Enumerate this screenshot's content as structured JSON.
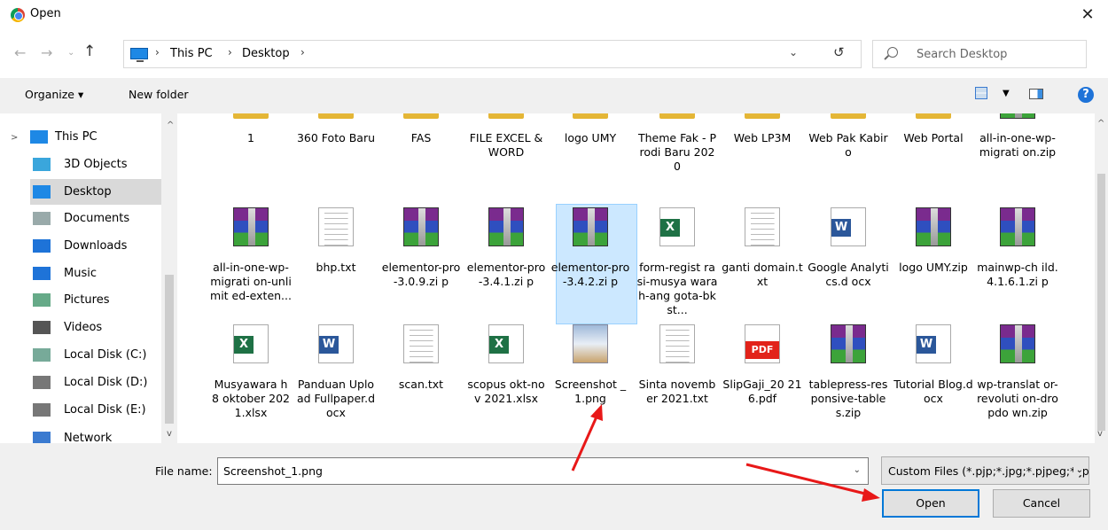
{
  "window": {
    "title": "Open",
    "close": "✕"
  },
  "nav": {
    "back": "←",
    "forward": "→",
    "recent": "⌄",
    "up": "↑",
    "crumbs": [
      "This PC",
      "Desktop"
    ],
    "refresh": "↻",
    "search_placeholder": "Search Desktop"
  },
  "toolbar": {
    "organize": "Organize ▾",
    "new_folder": "New folder",
    "help": "?"
  },
  "sidebar": {
    "items": [
      {
        "label": "This PC",
        "icon": "pc-icon"
      },
      {
        "label": "3D Objects",
        "icon": "cube-icon"
      },
      {
        "label": "Desktop",
        "icon": "desktop-icon",
        "selected": true
      },
      {
        "label": "Documents",
        "icon": "document-icon"
      },
      {
        "label": "Downloads",
        "icon": "download-icon"
      },
      {
        "label": "Music",
        "icon": "music-icon"
      },
      {
        "label": "Pictures",
        "icon": "pictures-icon"
      },
      {
        "label": "Videos",
        "icon": "video-icon"
      },
      {
        "label": "Local Disk (C:)",
        "icon": "drive-c-icon"
      },
      {
        "label": "Local Disk (D:)",
        "icon": "drive-icon"
      },
      {
        "label": "Local Disk (E:)",
        "icon": "drive-icon"
      },
      {
        "label": "Network",
        "icon": "network-icon"
      }
    ]
  },
  "files": [
    {
      "name": "1",
      "type": "folder"
    },
    {
      "name": "360 Foto Baru",
      "type": "folder"
    },
    {
      "name": "FAS",
      "type": "folder"
    },
    {
      "name": "FILE EXCEL & WORD",
      "type": "folder"
    },
    {
      "name": "logo UMY",
      "type": "folder"
    },
    {
      "name": "Theme Fak - Prodi Baru 2020",
      "type": "folder"
    },
    {
      "name": "Web LP3M",
      "type": "folder"
    },
    {
      "name": "Web Pak Kabiro",
      "type": "folder"
    },
    {
      "name": "Web Portal",
      "type": "folder"
    },
    {
      "name": "all-in-one-wp-migrati on.zip",
      "type": "rar"
    },
    {
      "name": "all-in-one-wp-migrati on-unlimit ed-exten...",
      "type": "rar"
    },
    {
      "name": "bhp.txt",
      "type": "txt"
    },
    {
      "name": "elementor-pro-3.0.9.zi p",
      "type": "rar"
    },
    {
      "name": "elementor-pro-3.4.1.zi p",
      "type": "rar"
    },
    {
      "name": "elementor-pro-3.4.2.zi p",
      "type": "rar"
    },
    {
      "name": "form-regist rasi-musya warah-ang gota-bkst...",
      "type": "xl"
    },
    {
      "name": "ganti domain.txt",
      "type": "txt"
    },
    {
      "name": "Google Analytics.d ocx",
      "type": "wd"
    },
    {
      "name": "logo UMY.zip",
      "type": "rar"
    },
    {
      "name": "mainwp-ch ild.4.1.6.1.zi p",
      "type": "rar"
    },
    {
      "name": "Musyawara h 8 oktober 2021.xlsx",
      "type": "xl"
    },
    {
      "name": "Panduan Upload Fullpaper.d ocx",
      "type": "wd"
    },
    {
      "name": "scan.txt",
      "type": "txt"
    },
    {
      "name": "scopus okt-nov 2021.xlsx",
      "type": "xl"
    },
    {
      "name": "Screenshot _1.png",
      "type": "img",
      "selected": true
    },
    {
      "name": "Sinta november 2021.txt",
      "type": "txt"
    },
    {
      "name": "SlipGaji_20 216.pdf",
      "type": "pdf"
    },
    {
      "name": "tablepress-responsive-tables.zip",
      "type": "rar"
    },
    {
      "name": "Tutorial Blog.docx",
      "type": "wd"
    },
    {
      "name": "wp-translat or-revoluti on-dropdo wn.zip",
      "type": "rar"
    }
  ],
  "badges": {
    "xl": "X",
    "wd": "W",
    "pdf": "PDF"
  },
  "bottom": {
    "file_name_label": "File name:",
    "file_name_value": "Screenshot_1.png",
    "filter": "Custom Files (*.pjp;*.jpg;*.pjpeg;*.jpeg;*.jfif;*.png)",
    "open": "Open",
    "cancel": "Cancel"
  },
  "colors": {
    "selection": "#cce8ff",
    "accent": "#0078d7",
    "annotation_arrow": "#e81818"
  }
}
